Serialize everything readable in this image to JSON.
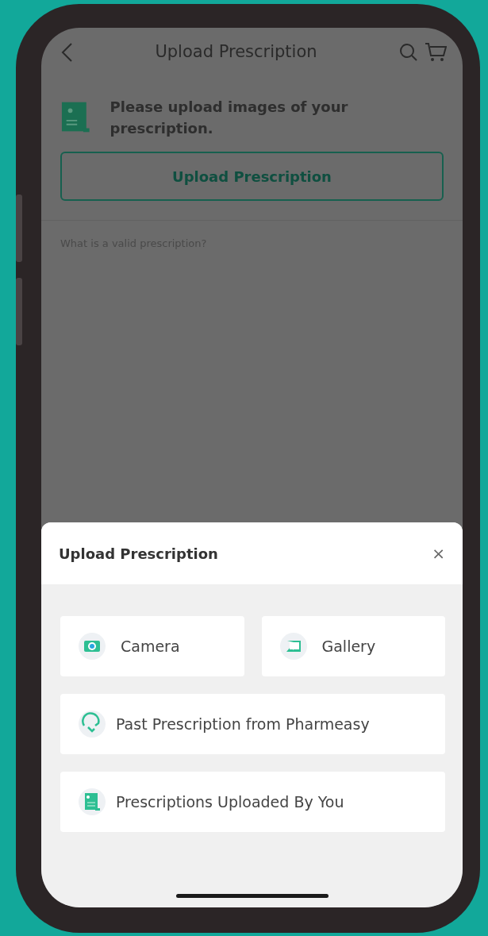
{
  "header": {
    "title": "Upload Prescription"
  },
  "info": {
    "message": "Please upload images of your prescription."
  },
  "upload_button": {
    "label": "Upload Prescription"
  },
  "help_link": {
    "label": "What is a valid prescription?"
  },
  "sheet": {
    "title": "Upload Prescription",
    "close": "×",
    "options": [
      {
        "kind": "half",
        "label": "Camera"
      },
      {
        "kind": "half",
        "label": "Gallery"
      },
      {
        "kind": "full",
        "label": "Past Prescription from Pharmeasy"
      },
      {
        "kind": "full",
        "label": "Prescriptions Uploaded By You"
      }
    ]
  }
}
